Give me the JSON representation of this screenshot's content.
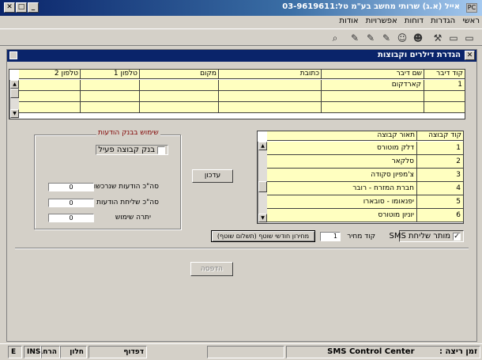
{
  "window": {
    "title": "אייל (א.ג) שרותי מחשב בע\"מ טל:03-9619611",
    "sys_icon": "PC",
    "minimize_glyph": "_",
    "maximize_glyph": "□",
    "close_glyph": "✕"
  },
  "menu": [
    "ראשי",
    "הגדרות",
    "דוחות",
    "אפשרויות",
    "אודות"
  ],
  "toolbar": {
    "icons": [
      "binoculars-icon",
      "pen-icon",
      "pen-add-icon",
      "pen-alt-icon",
      "user-settings-icon",
      "user-group-icon",
      "tools-icon",
      "folder-open-icon",
      "folder-icon",
      "folder-alt-icon"
    ],
    "glyphs": [
      "⌕",
      "✎",
      "✎",
      "✎",
      "☺",
      "☻",
      "⚒",
      "▭",
      "▭",
      "▭"
    ]
  },
  "subwindow": {
    "title": "הגדרת דילרים וקבוצות",
    "close_glyph": "✕"
  },
  "dealers_table": {
    "columns": [
      "קוד דיבר",
      "שם דיבר",
      "כתובת",
      "מקום",
      "טלפון 1",
      "טלפון 2"
    ],
    "rows": [
      [
        "1",
        "קארדקום",
        "",
        "",
        "",
        ""
      ],
      [
        "",
        "",
        "",
        "",
        "",
        ""
      ],
      [
        "",
        "",
        "",
        "",
        "",
        ""
      ]
    ]
  },
  "groups_table": {
    "columns": [
      "קוד קבוצה",
      "תאור קבוצה"
    ],
    "rows": [
      [
        "1",
        "דלק מוטורס"
      ],
      [
        "2",
        "סלקאר"
      ],
      [
        "3",
        "צ'מפיון סקודה"
      ],
      [
        "4",
        "חברת המזרח - רובר"
      ],
      [
        "5",
        "יפנאומו - סובארו"
      ],
      [
        "6",
        "יוניון מוטורס"
      ]
    ]
  },
  "update_button": "עדכון",
  "messages_group": {
    "title": "שימוש בבנק הודעות",
    "active_checkbox_label": "בנק קבוצה פעיל",
    "purchased_label": "סה\"כ הודעות שנרכשו",
    "purchased_value": "0",
    "sent_label": "סה\"כ שליחת הודעות",
    "sent_value": "0",
    "balance_label": "יתרה שימוש",
    "balance_value": "0"
  },
  "sms_allowed": {
    "label": "מותר שליחת SMS",
    "checked_glyph": "✓"
  },
  "price_code": {
    "label": "קוד מחיר",
    "value": "1"
  },
  "price_list_button": "מחירון חודשי שוטף (תשלום שוטף)",
  "print_button": "הדפסה",
  "statusbar": {
    "app_name": "SMS Control Center",
    "runtime_label": "זמן ריצה :",
    "pane_page": "דפדוף",
    "pane_window": "חלון",
    "pane_mode": "הרחב",
    "pane_ins": "INS",
    "pane_lang": "E"
  }
}
